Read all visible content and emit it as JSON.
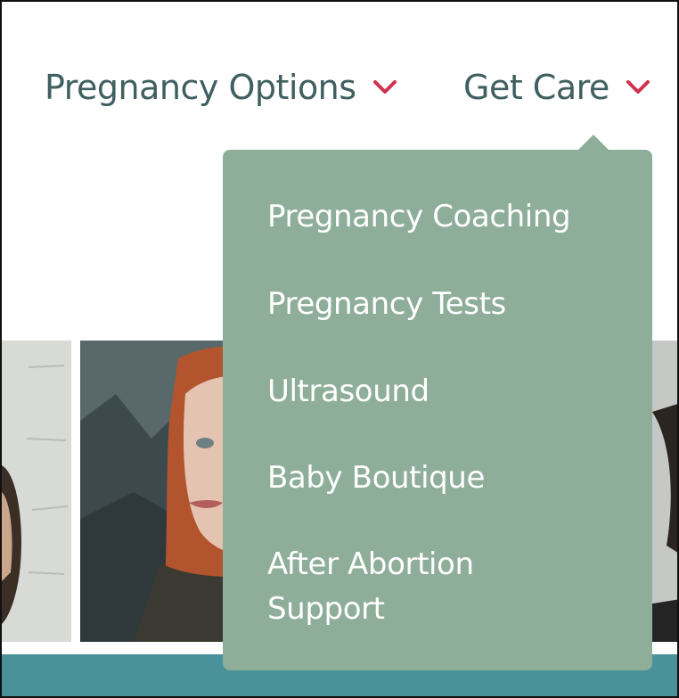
{
  "nav": {
    "items": [
      {
        "label": "Pregnancy Options",
        "icon": "chevron-down-icon"
      },
      {
        "label": "Get Care",
        "icon": "chevron-down-icon"
      }
    ]
  },
  "dropdown": {
    "items": [
      {
        "label": "Pregnancy Coaching"
      },
      {
        "label": "Pregnancy Tests"
      },
      {
        "label": "Ultrasound"
      },
      {
        "label": "Baby Boutique"
      },
      {
        "label": "After Abortion\nSupport"
      }
    ]
  },
  "colors": {
    "nav_text": "#3f5f60",
    "chevron": "#d0314f",
    "dropdown_bg": "#8eae9a",
    "band": "#4a929b"
  }
}
